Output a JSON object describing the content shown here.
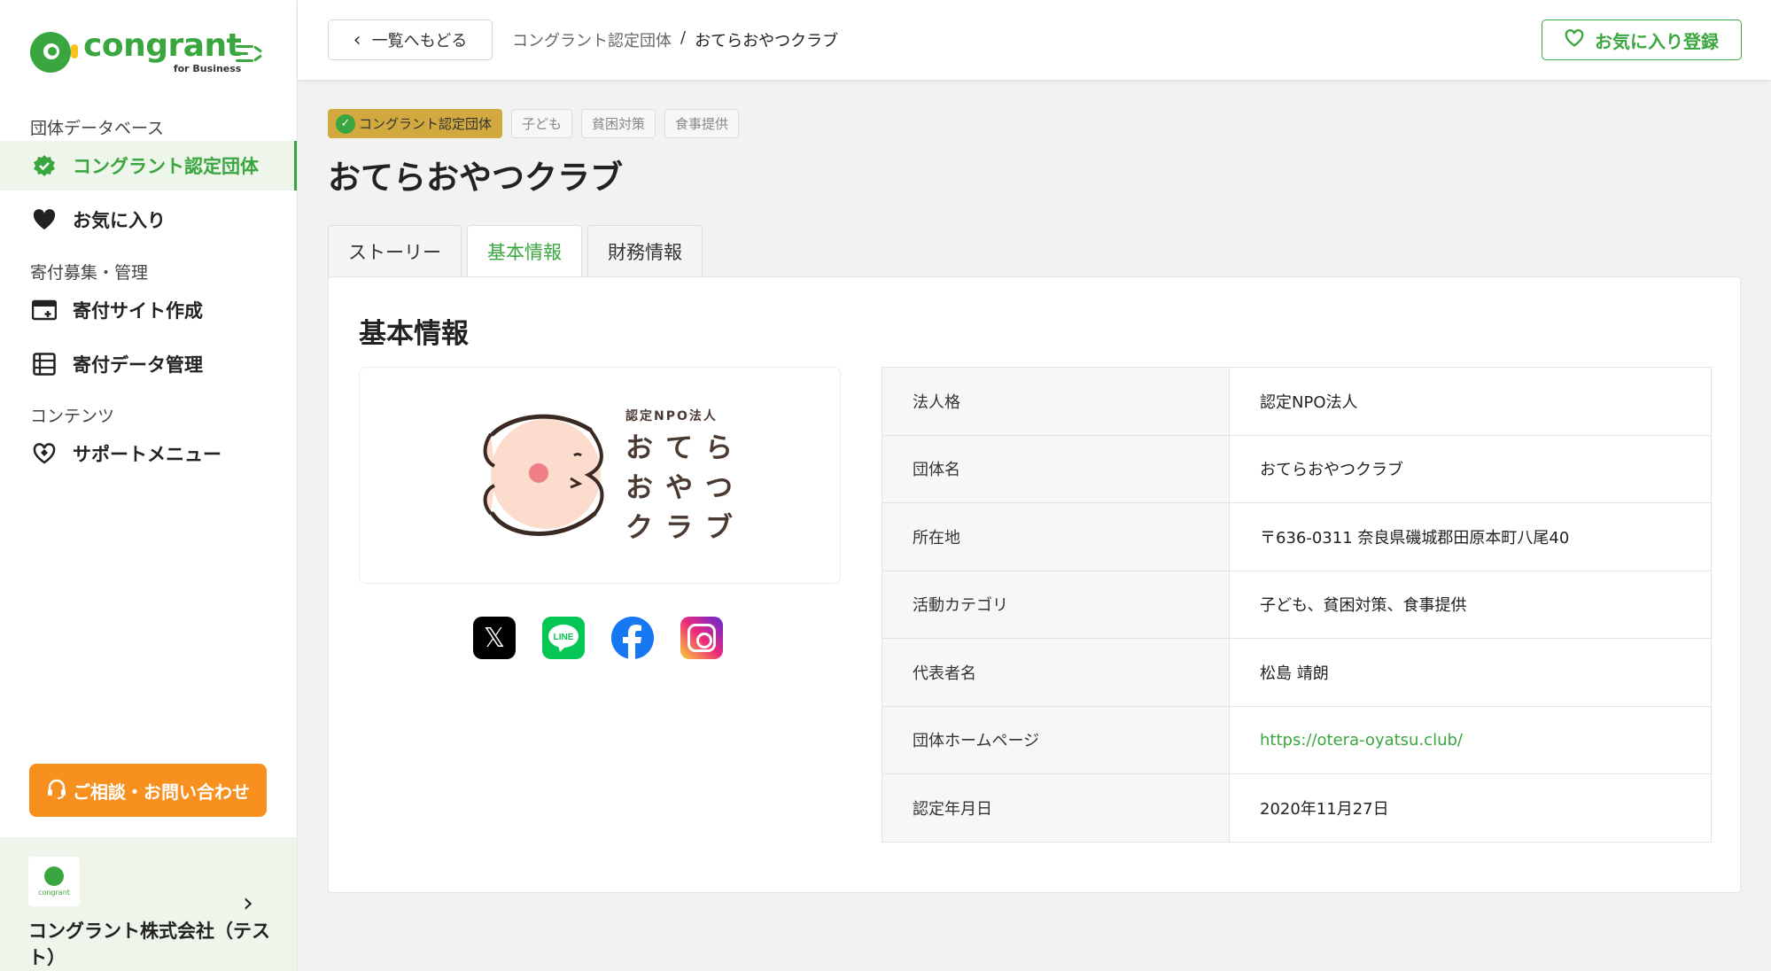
{
  "brand": {
    "name": "congrant",
    "sub": "for Business"
  },
  "sidebar": {
    "section_db": "団体データベース",
    "item_certified": "コングラント認定団体",
    "item_favorites": "お気に入り",
    "section_donation": "寄付募集・管理",
    "item_site": "寄付サイト作成",
    "item_data": "寄付データ管理",
    "section_contents": "コンテンツ",
    "item_support": "サポートメニュー",
    "contact_button": "ご相談・お問い合わせ",
    "org_logo_text": "congrant",
    "org_name": "コングラント株式会社（テスト）"
  },
  "header": {
    "back_label": "一覧へもどる",
    "breadcrumb_parent": "コングラント認定団体",
    "breadcrumb_sep": "/",
    "breadcrumb_current": "おてらおやつクラブ",
    "favorite_button": "お気に入り登録"
  },
  "tags": [
    "子ども",
    "貧困対策",
    "食事提供"
  ],
  "certified_tag": "コングラント認定団体",
  "title": "おてらおやつクラブ",
  "tabs": [
    "ストーリー",
    "基本情報",
    "財務情報"
  ],
  "active_tab": "基本情報",
  "section_title": "基本情報",
  "logo": {
    "line1": "認定NPO法人",
    "line2": "おてら",
    "line3": "おやつ",
    "line4": "クラブ"
  },
  "socials": [
    "X",
    "LINE",
    "Facebook",
    "Instagram"
  ],
  "info": {
    "rows": [
      {
        "key": "法人格",
        "value": "認定NPO法人"
      },
      {
        "key": "団体名",
        "value": "おてらおやつクラブ"
      },
      {
        "key": "所在地",
        "value": "〒636-0311 奈良県磯城郡田原本町八尾40"
      },
      {
        "key": "活動カテゴリ",
        "value": "子ども、貧困対策、食事提供"
      },
      {
        "key": "代表者名",
        "value": "松島 靖朗"
      },
      {
        "key": "団体ホームページ",
        "value": "https://otera-oyatsu.club/"
      },
      {
        "key": "認定年月日",
        "value": "2020年11月27日"
      }
    ]
  },
  "colors": {
    "brand_green": "#3aa63f",
    "accent_orange": "#f7901e",
    "cert_gold": "#d1a93e"
  }
}
